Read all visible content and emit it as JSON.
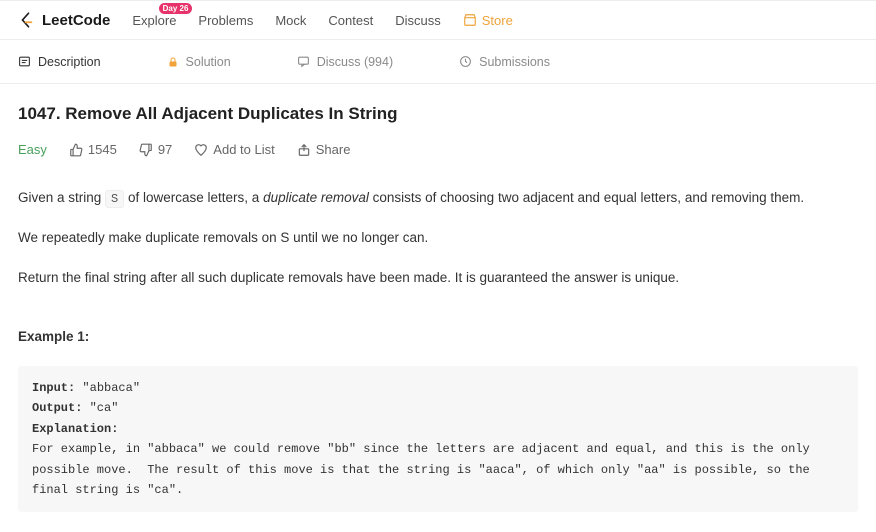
{
  "logo": {
    "text": "LeetCode"
  },
  "nav": {
    "explore": "Explore",
    "explore_badge": "Day 26",
    "problems": "Problems",
    "mock": "Mock",
    "contest": "Contest",
    "discuss": "Discuss",
    "store": "Store"
  },
  "tabs": {
    "description": "Description",
    "solution": "Solution",
    "discuss": "Discuss (994)",
    "submissions": "Submissions"
  },
  "problem": {
    "title": "1047. Remove All Adjacent Duplicates In String",
    "difficulty": "Easy",
    "likes": "1545",
    "dislikes": "97",
    "add_to_list": "Add to List",
    "share": "Share",
    "desc_p1_a": "Given a string ",
    "desc_p1_code": "S",
    "desc_p1_b": " of lowercase letters, a ",
    "desc_p1_em": "duplicate removal",
    "desc_p1_c": " consists of choosing two adjacent and equal letters, and removing them.",
    "desc_p2": "We repeatedly make duplicate removals on S until we no longer can.",
    "desc_p3": "Return the final string after all such duplicate removals have been made.  It is guaranteed the answer is unique.",
    "example_label": "Example 1:",
    "example": {
      "input_label": "Input: ",
      "input_val": "\"abbaca\"",
      "output_label": "Output: ",
      "output_val": "\"ca\"",
      "explanation_label": "Explanation: ",
      "explanation_text": "For example, in \"abbaca\" we could remove \"bb\" since the letters are adjacent and equal, and this is the only possible move.  The result of this move is that the string is \"aaca\", of which only \"aa\" is possible, so the final string is \"ca\"."
    }
  }
}
